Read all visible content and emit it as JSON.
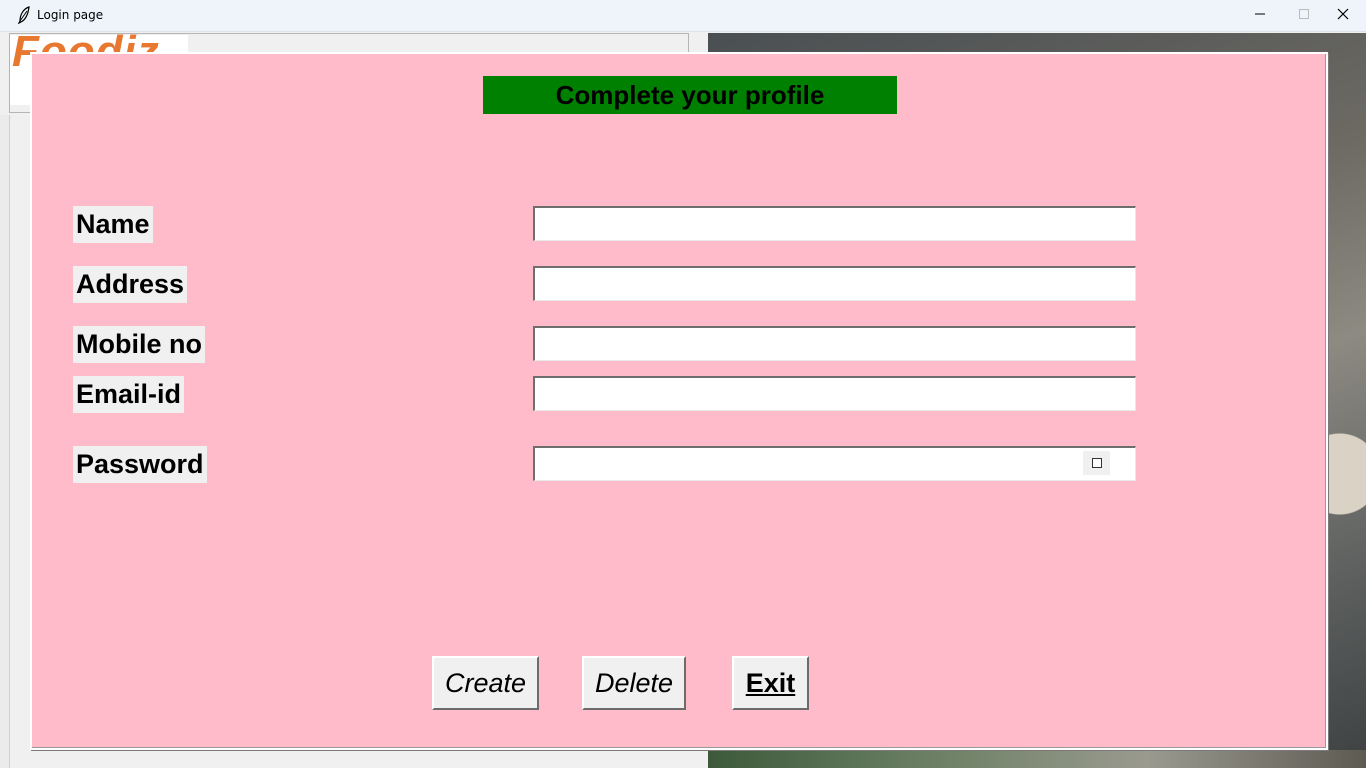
{
  "window": {
    "title": "Login page",
    "minimize_icon": "minimize-icon",
    "maximize_icon": "maximize-icon",
    "close_icon": "close-icon"
  },
  "background": {
    "logo_text": "Foodiz"
  },
  "form": {
    "heading": "Complete your profile",
    "heading_bg": "#008000",
    "panel_bg": "#ffbbca",
    "fields": [
      {
        "label": "Name",
        "value": ""
      },
      {
        "label": "Address",
        "value": ""
      },
      {
        "label": "Mobile no",
        "value": ""
      },
      {
        "label": "Email-id",
        "value": ""
      },
      {
        "label": "Password",
        "value": ""
      }
    ],
    "show_password_checked": false
  },
  "buttons": {
    "create": "Create",
    "delete": "Delete",
    "exit": "Exit"
  }
}
